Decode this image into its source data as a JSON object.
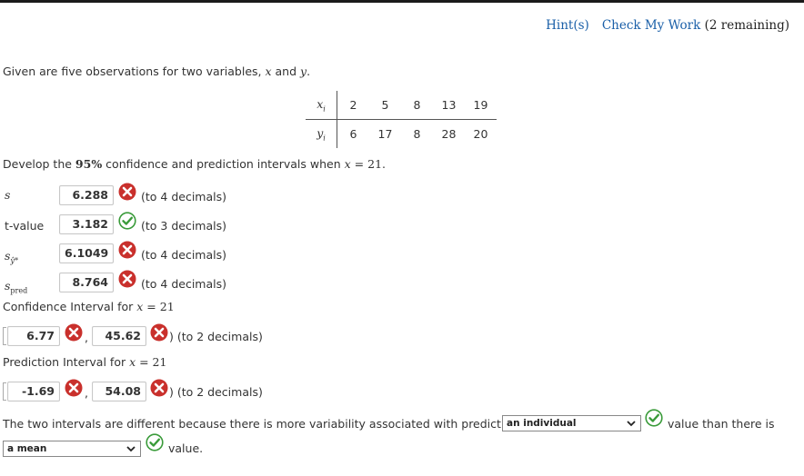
{
  "links": {
    "hint": "Hint(s)",
    "check": "Check My Work",
    "remaining": "(2 remaining)"
  },
  "intro": {
    "text": "Given are five observations for two variables, ",
    "x": "x",
    "and": " and ",
    "y": "y",
    "end": "."
  },
  "table": {
    "row1_label": "xi",
    "row1": [
      "2",
      "5",
      "8",
      "13",
      "19"
    ],
    "row2_label": "yi",
    "row2": [
      "6",
      "17",
      "8",
      "28",
      "20"
    ]
  },
  "develop": {
    "pre": "Develop the ",
    "pct": "95%",
    "mid": " confidence and prediction intervals when ",
    "x": "x",
    "eq": " = 21",
    "end": "."
  },
  "answers": [
    {
      "label": "s",
      "value": "6.288",
      "hint": "(to 4 decimals)",
      "status": "wrong"
    },
    {
      "label": "t-value",
      "value": "3.182",
      "hint": "(to 3 decimals)",
      "status": "correct"
    },
    {
      "label": "sŷ*",
      "value": "6.1049",
      "hint": "(to 4 decimals)",
      "status": "wrong"
    },
    {
      "label": "spred",
      "value": "8.764",
      "hint": "(to 4 decimals)",
      "status": "wrong"
    }
  ],
  "ci": {
    "label": "Confidence Interval for ",
    "x": "x",
    "eq": " = 21",
    "lower": "6.77",
    "upper": "45.62",
    "hint": ") (to 2 decimals)"
  },
  "pi": {
    "label": "Prediction Interval for ",
    "x": "x",
    "eq": " = 21",
    "lower": "-1.69",
    "upper": "54.08",
    "hint": ") (to 2 decimals)"
  },
  "final": {
    "pre": "The two intervals are different because there is more variability associated with predicting",
    "select1": "an individual",
    "mid": "value than there is",
    "select2": "a mean",
    "end": "value."
  },
  "colors": {
    "link": "#1a5fa8",
    "wrong": "#c9302c",
    "correct": "#3a9b3a"
  }
}
